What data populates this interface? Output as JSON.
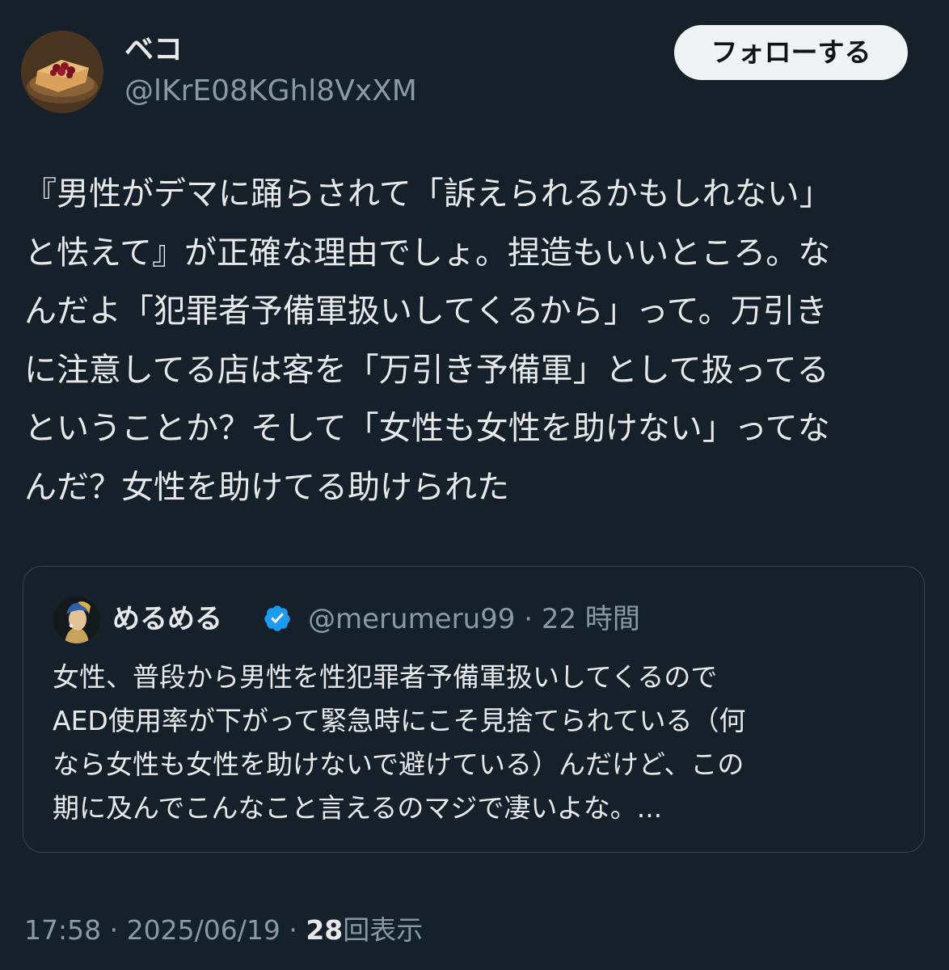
{
  "author": {
    "display_name": "ベコ",
    "handle": "@lKrE08KGhl8VxXM",
    "avatar_icon": "toast-with-jam-avatar"
  },
  "follow_button_label": "フォローする",
  "tweet": {
    "text": "『男性がデマに踊らされて「訴えられるかもしれない」\nと怯えて』が正確な理由でしょ。捏造もいいところ。な\nんだよ「犯罪者予備軍扱いしてくるから」って。万引き\nに注意してる店は客を「万引き予備軍」として扱ってる\nということか？そして「女性も女性を助けない」ってな\nんだ？女性を助けてる助けられた"
  },
  "quoted_tweet": {
    "display_name": "めるめる",
    "verified_icon": "verified-badge-icon",
    "handle": "@merumeru99",
    "separator": "·",
    "time_ago": "22 時間",
    "text": "女性、普段から男性を性犯罪者予備軍扱いしてくるので\nAED使用率が下がって緊急時にこそ見捨てられている（何\nなら女性も女性を助けないで避けている）んだけど、この\n期に及んでこんなこと言えるのマジで凄いよな。...",
    "avatar_icon": "girl-with-pearl-earring-avatar"
  },
  "footer": {
    "time": "17:58",
    "date": "2025/06/19",
    "separator": "·",
    "views_count": "28",
    "views_label": "回表示"
  },
  "colors": {
    "background": "#15202b",
    "text_primary": "#e7e9ea",
    "text_secondary": "#8b98a5",
    "border": "#38444d",
    "verified": "#1d9bf0",
    "button_bg": "#eff3f4"
  }
}
